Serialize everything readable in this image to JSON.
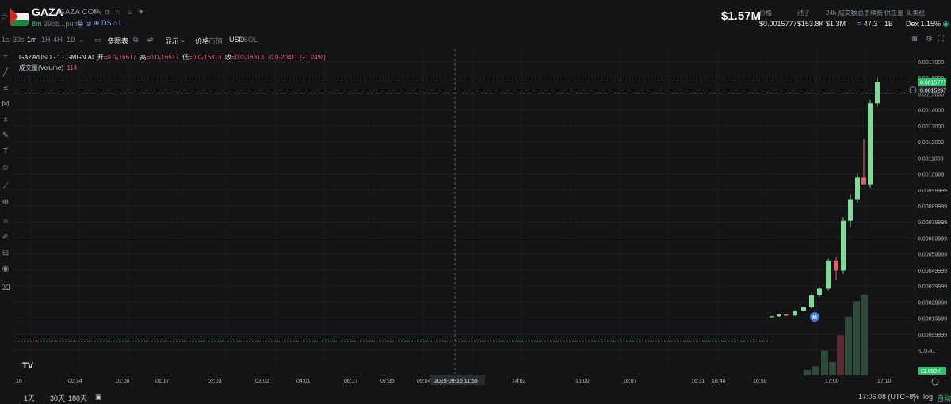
{
  "header": {
    "symbol": "GAZA",
    "name": "GAZA COIN",
    "age": "8m",
    "address": "39ob...pump",
    "social_tag": "DS",
    "holders_badge": "1",
    "market_cap": "$1.57M",
    "stats": [
      {
        "label": "价格",
        "value": "$0.0015777"
      },
      {
        "label": "池子",
        "value": "$153.8K"
      },
      {
        "label": "24h 成交额",
        "value": "$1.3M"
      },
      {
        "label": "总手续费",
        "value": "47.3"
      },
      {
        "label": "供应量",
        "value": "1B"
      },
      {
        "label": "买卖税",
        "value": "Dex 1.15%"
      }
    ]
  },
  "toolbar": {
    "intervals": [
      "1s",
      "30s",
      "1m",
      "1H",
      "4H",
      "1D"
    ],
    "active_interval": "1m",
    "multi_chart": "多图表",
    "display": "显示",
    "price_label": "价格",
    "mcap_label": "市值",
    "usd_label": "USD",
    "sol_label": "SOL"
  },
  "legend": {
    "pair": "GAZA/USD · 1 · GMGN.AI",
    "o_label": "开",
    "o_value": "=0.0₅16517",
    "h_label": "高",
    "h_value": "=0.0₅16517",
    "l_label": "低",
    "l_value": "=0.0₅16313",
    "c_label": "收",
    "c_value": "=0.0₅16313",
    "change": "-0.0₇20411 (−1.24%)",
    "volume_label": "成交量(Volume)",
    "volume_value": "114"
  },
  "bottom": {
    "ranges": [
      "1天",
      "30天",
      "180天"
    ],
    "clock": "17:06:08 (UTC+8)",
    "percent": "%",
    "log": "log",
    "auto": "自动"
  },
  "colors": {
    "up": "#7ddc98",
    "down": "#e0606c",
    "volume_up": "#2f4a39",
    "volume_down": "#5a2a30"
  },
  "chart_data": {
    "type": "candlestick",
    "price_axis": [
      "0.0017000",
      "0.0016000",
      "0.0015000",
      "0.0014000",
      "0.0013000",
      "0.0012000",
      "0.0011000",
      "0.0010999",
      "0.00099999",
      "0.00089999",
      "0.00079999",
      "0.00069999",
      "0.00059999",
      "0.00049999",
      "0.00039999",
      "0.00029999",
      "0.00019999",
      "0.00099999",
      "-0.0₇41"
    ],
    "time_axis": [
      "16",
      "00:34",
      "01:00",
      "01:17",
      "02:03",
      "03:02",
      "04:01",
      "06:17",
      "07:35",
      "09:04",
      "2025-09-16  11:55",
      "14:02",
      "15:00",
      "16:07",
      "16:31",
      "16:40",
      "16:50",
      "17:00",
      "17:10"
    ],
    "last_price": "0.0015777",
    "crosshair_price": "0.0015297",
    "volume_axis_label": "13.052K",
    "candles": [
      {
        "o": 0.00016,
        "h": 0.000165,
        "l": 0.000158,
        "c": 0.000163
      },
      {
        "o": 0.000163,
        "h": 0.000178,
        "l": 0.00016,
        "c": 0.000175
      },
      {
        "o": 0.000175,
        "h": 0.000178,
        "l": 0.000164,
        "c": 0.000168
      },
      {
        "o": 0.000168,
        "h": 0.0002,
        "l": 0.000166,
        "c": 0.000198
      },
      {
        "o": 0.000198,
        "h": 0.00022,
        "l": 0.000196,
        "c": 0.000218
      },
      {
        "o": 0.000218,
        "h": 0.0003,
        "l": 0.00021,
        "c": 0.00029
      },
      {
        "o": 0.00029,
        "h": 0.00034,
        "l": 0.00028,
        "c": 0.00033
      },
      {
        "o": 0.00033,
        "h": 0.00051,
        "l": 0.00032,
        "c": 0.0005
      },
      {
        "o": 0.0005,
        "h": 0.00052,
        "l": 0.00038,
        "c": 0.00044
      },
      {
        "o": 0.00044,
        "h": 0.00076,
        "l": 0.00042,
        "c": 0.00074
      },
      {
        "o": 0.00074,
        "h": 0.0009,
        "l": 0.0007,
        "c": 0.00087
      },
      {
        "o": 0.00087,
        "h": 0.00102,
        "l": 0.00085,
        "c": 0.001
      },
      {
        "o": 0.001,
        "h": 0.00123,
        "l": 0.00098,
        "c": 0.00096
      },
      {
        "o": 0.00096,
        "h": 0.00147,
        "l": 0.00094,
        "c": 0.00145
      },
      {
        "o": 0.00145,
        "h": 0.00161,
        "l": 0.00143,
        "c": 0.001578
      }
    ],
    "volumes": [
      900,
      1500,
      4000,
      2200,
      6500,
      9500,
      12000,
      13052
    ]
  }
}
